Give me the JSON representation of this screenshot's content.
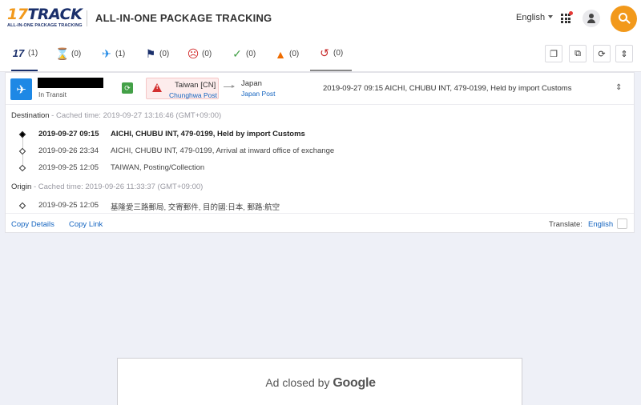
{
  "header": {
    "logo_main_a": "17",
    "logo_main_b": "TRACK",
    "logo_sub": "ALL-IN-ONE PACKAGE TRACKING",
    "title": "ALL-IN-ONE PACKAGE TRACKING",
    "language": "English",
    "icons": [
      "apps-grid-icon",
      "user-icon",
      "search-icon"
    ]
  },
  "tabs": [
    {
      "icon": "17-icon",
      "count": "(1)"
    },
    {
      "icon": "hourglass-icon",
      "count": "(0)"
    },
    {
      "icon": "airplane-icon",
      "count": "(1)"
    },
    {
      "icon": "flag-icon",
      "count": "(0)"
    },
    {
      "icon": "sad-face-icon",
      "count": "(0)"
    },
    {
      "icon": "check-icon",
      "count": "(0)"
    },
    {
      "icon": "warning-icon",
      "count": "(0)"
    },
    {
      "icon": "history-icon",
      "count": "(0)"
    }
  ],
  "toolbar": {
    "icons": [
      "copy-icon",
      "copy-all-icon",
      "refresh-icon",
      "collapse-icon"
    ]
  },
  "shipment": {
    "status": "In Transit",
    "origin_country": "Taiwan [CN]",
    "origin_carrier": "Chunghwa Post",
    "dest_country": "Japan",
    "dest_carrier": "Japan Post",
    "latest_event": "2019-09-27 09:15  AICHI, CHUBU INT, 479-0199, Held by import Customs",
    "colors": {
      "status": "#1e88e5",
      "warning": "#d32f2f",
      "sync": "#43a047"
    }
  },
  "destination": {
    "label": "Destination",
    "cached": " - Cached time: 2019-09-27 13:16:46 (GMT+09:00)",
    "events": [
      {
        "time": "2019-09-27 09:15",
        "desc": "AICHI, CHUBU INT, 479-0199, Held by import Customs"
      },
      {
        "time": "2019-09-26 23:34",
        "desc": "AICHI, CHUBU INT, 479-0199, Arrival at inward office of exchange"
      },
      {
        "time": "2019-09-25 12:05",
        "desc": "TAIWAN, Posting/Collection"
      }
    ]
  },
  "origin": {
    "label": "Origin",
    "cached": " - Cached time: 2019-09-26 11:33:37 (GMT+09:00)",
    "events": [
      {
        "time": "2019-09-25 12:05",
        "desc": "基隆愛三路郵局, 交寄郵件, 目的國:日本, 郵路:航空"
      }
    ]
  },
  "footer": {
    "copy_details": "Copy Details",
    "copy_link": "Copy Link",
    "translate_label": "Translate:",
    "translate_lang": "English"
  },
  "ad": {
    "text": "Ad closed by",
    "brand": "Google"
  }
}
